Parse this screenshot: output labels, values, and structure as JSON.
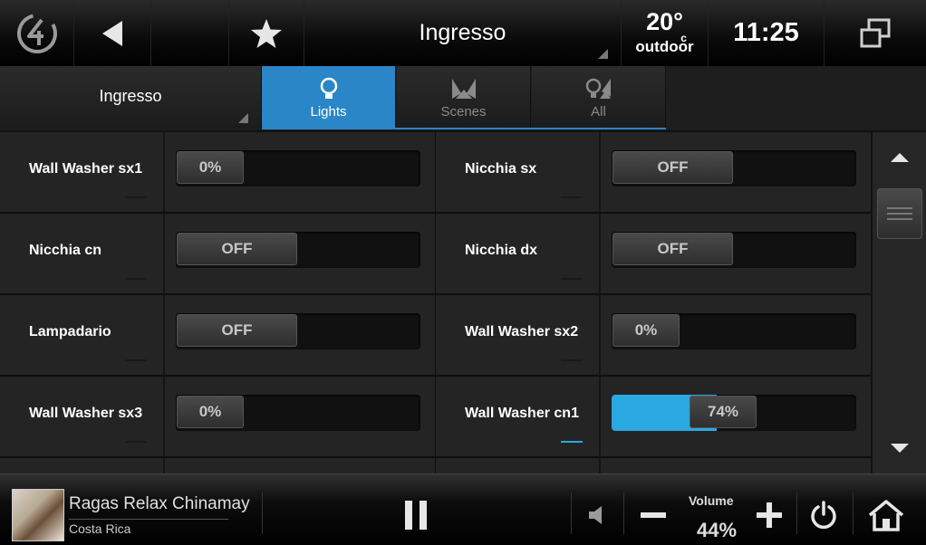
{
  "topbar": {
    "title": "Ingresso",
    "temperature": "20°",
    "temperature_unit": "c",
    "weather_label": "outdoor",
    "clock": "11:25"
  },
  "tabbar": {
    "room": "Ingresso",
    "tabs": [
      {
        "label": "Lights",
        "icon": "bulb-icon",
        "active": true
      },
      {
        "label": "Scenes",
        "icon": "scenes-icon",
        "active": false
      },
      {
        "label": "All",
        "icon": "all-icon",
        "active": false
      }
    ]
  },
  "devices": [
    {
      "name": "Wall Washer sx1",
      "value": "0%",
      "level": 0,
      "on": false
    },
    {
      "name": "Nicchia sx",
      "value": "OFF",
      "level": 0,
      "on": false
    },
    {
      "name": "Nicchia cn",
      "value": "OFF",
      "level": 0,
      "on": false
    },
    {
      "name": "Nicchia dx",
      "value": "OFF",
      "level": 0,
      "on": false
    },
    {
      "name": "Lampadario",
      "value": "OFF",
      "level": 0,
      "on": false
    },
    {
      "name": "Wall Washer sx2",
      "value": "0%",
      "level": 0,
      "on": false
    },
    {
      "name": "Wall Washer sx3",
      "value": "0%",
      "level": 0,
      "on": false
    },
    {
      "name": "Wall Washer cn1",
      "value": "74%",
      "level": 74,
      "on": true
    }
  ],
  "player": {
    "track": "Ragas Relax Chinamayi",
    "artist": "Costa Rica",
    "volume_label": "Volume",
    "volume": "44%"
  },
  "colors": {
    "accent": "#2aa8e0",
    "tab_active": "#2a86c6"
  }
}
